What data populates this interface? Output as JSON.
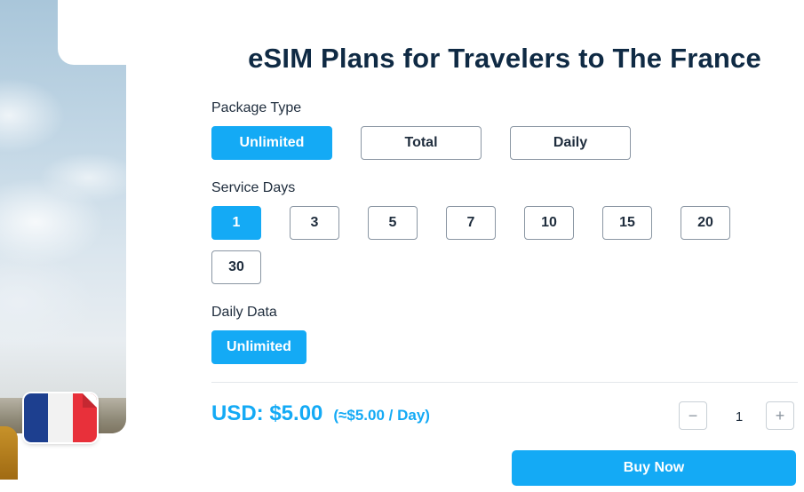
{
  "title": "eSIM Plans for Travelers to The France",
  "package_type": {
    "label": "Package Type",
    "options": [
      "Unlimited",
      "Total",
      "Daily"
    ],
    "selected": "Unlimited"
  },
  "service_days": {
    "label": "Service Days",
    "options": [
      "1",
      "3",
      "5",
      "7",
      "10",
      "15",
      "20",
      "30"
    ],
    "selected": "1"
  },
  "daily_data": {
    "label": "Daily Data",
    "options": [
      "Unlimited"
    ],
    "selected": "Unlimited"
  },
  "price": {
    "main": "USD: $5.00",
    "per_day": "(≈$5.00 / Day)"
  },
  "quantity": {
    "minus": "−",
    "value": "1",
    "plus": "+"
  },
  "buy_label": "Buy Now",
  "colors": {
    "accent": "#14aaf5",
    "title": "#0f2a44",
    "flag_blue": "#1d3f8f",
    "flag_red": "#e8303a"
  },
  "icons": {
    "flag": "france-flag-icon",
    "minus": "minus-icon",
    "plus": "plus-icon"
  }
}
